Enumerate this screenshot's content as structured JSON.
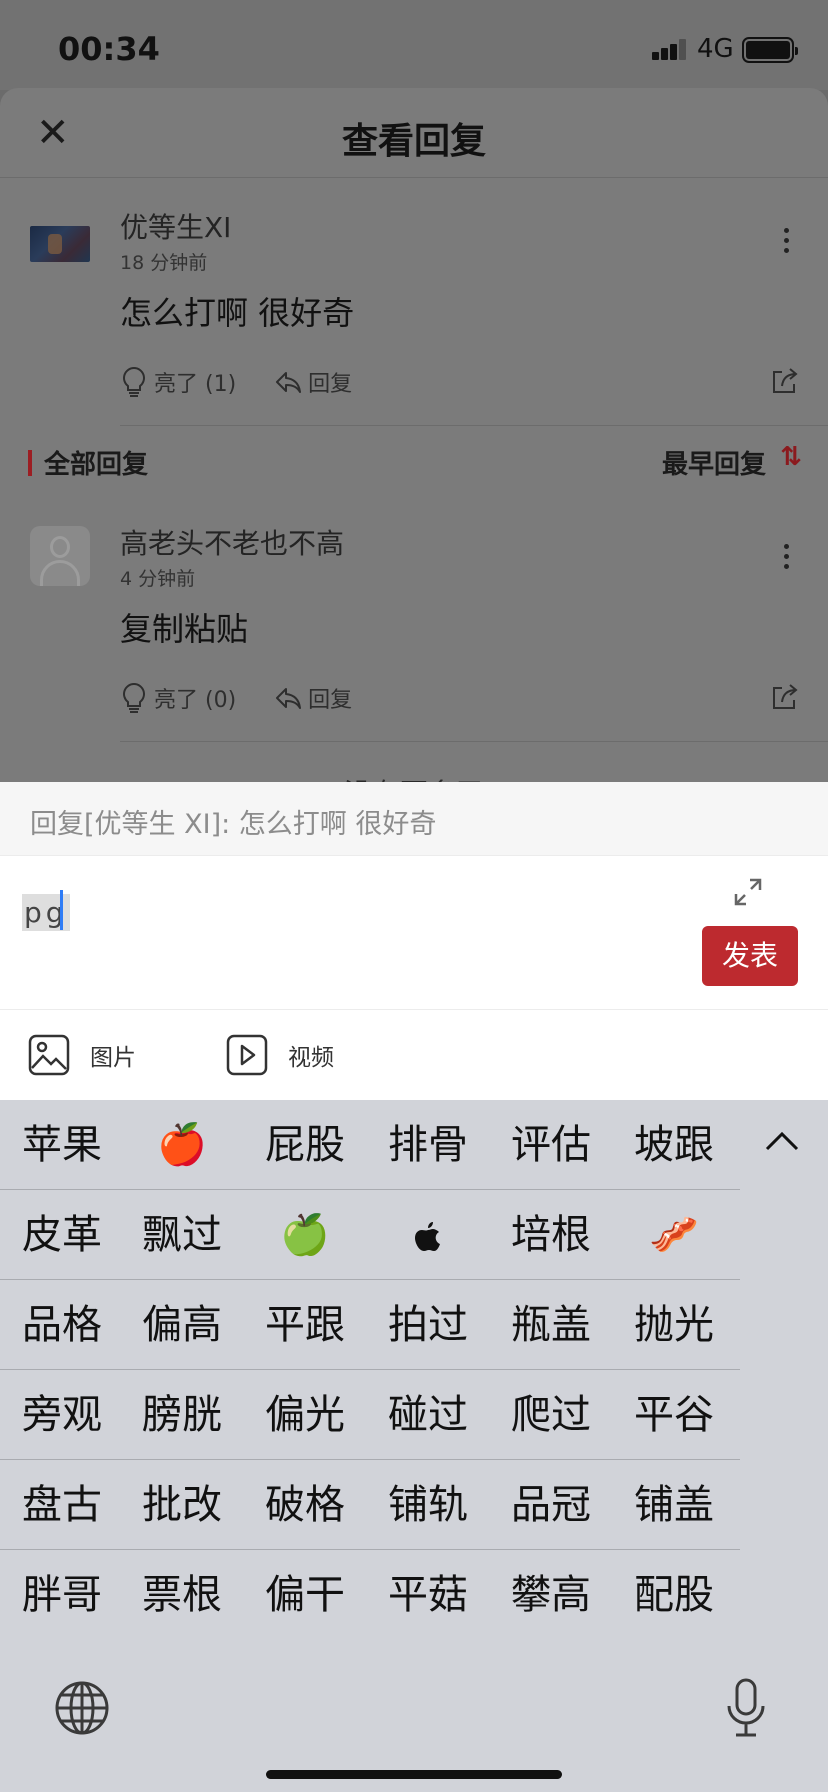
{
  "status": {
    "time": "00:34",
    "network": "4G"
  },
  "header": {
    "title": "查看回复",
    "close_icon": "close-icon"
  },
  "original_post": {
    "author": "优等生XI",
    "time": "18 分钟前",
    "content": "怎么打啊 很好奇",
    "like_label": "亮了 (1)",
    "reply_label": "回复"
  },
  "section": {
    "title": "全部回复",
    "sort_label": "最早回复",
    "sort_icon": "⇅"
  },
  "replies": [
    {
      "author": "高老头不老也不高",
      "time": "4 分钟前",
      "content": "复制粘贴",
      "like_label": "亮了 (0)",
      "reply_label": "回复"
    }
  ],
  "footer_hint": "没有更多了",
  "composer": {
    "reply_to": "回复[优等生 XI]:  怎么打啊 很好奇",
    "input_value": "pg",
    "submit_label": "发表",
    "image_label": "图片",
    "video_label": "视频"
  },
  "keyboard": {
    "rows": [
      [
        "苹果",
        "🍎",
        "屁股",
        "排骨",
        "评估",
        "坡跟"
      ],
      [
        "皮革",
        "飘过",
        "🍏",
        "",
        "培根",
        "🥓"
      ],
      [
        "品格",
        "偏高",
        "平跟",
        "拍过",
        "瓶盖",
        "抛光"
      ],
      [
        "旁观",
        "膀胱",
        "偏光",
        "碰过",
        "爬过",
        "平谷"
      ],
      [
        "盘古",
        "批改",
        "破格",
        "铺轨",
        "品冠",
        "铺盖"
      ],
      [
        "胖哥",
        "票根",
        "偏干",
        "平菇",
        "攀高",
        "配股"
      ]
    ]
  },
  "colors": {
    "accent": "#bd2a2f",
    "caret": "#2f7cf6",
    "keyboard_bg": "#d1d3d9"
  }
}
